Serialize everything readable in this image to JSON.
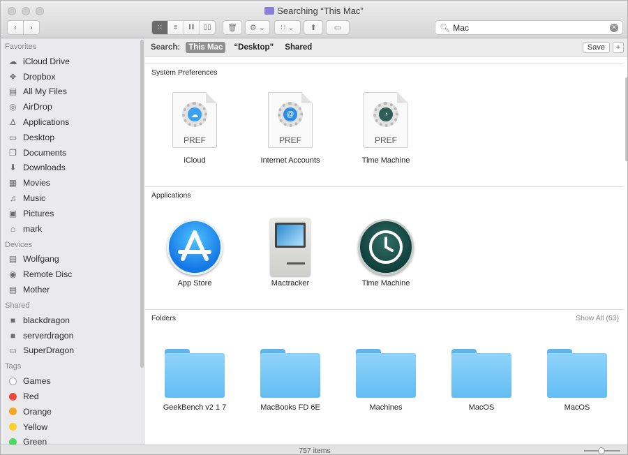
{
  "window": {
    "title": "Searching “This Mac”"
  },
  "toolbar": {
    "search_value": "Mac",
    "view_modes": [
      "icon",
      "list",
      "column",
      "cover-flow"
    ],
    "active_view": "icon"
  },
  "sidebar": {
    "favorites_header": "Favorites",
    "favorites": [
      {
        "label": "iCloud Drive",
        "icon": "cloud-icon"
      },
      {
        "label": "Dropbox",
        "icon": "dropbox-icon"
      },
      {
        "label": "All My Files",
        "icon": "all-files-icon"
      },
      {
        "label": "AirDrop",
        "icon": "airdrop-icon"
      },
      {
        "label": "Applications",
        "icon": "applications-icon"
      },
      {
        "label": "Desktop",
        "icon": "desktop-icon"
      },
      {
        "label": "Documents",
        "icon": "documents-icon"
      },
      {
        "label": "Downloads",
        "icon": "downloads-icon"
      },
      {
        "label": "Movies",
        "icon": "movies-icon"
      },
      {
        "label": "Music",
        "icon": "music-icon"
      },
      {
        "label": "Pictures",
        "icon": "pictures-icon"
      },
      {
        "label": "mark",
        "icon": "home-icon"
      }
    ],
    "devices_header": "Devices",
    "devices": [
      {
        "label": "Wolfgang",
        "icon": "hard-drive-icon"
      },
      {
        "label": "Remote Disc",
        "icon": "disc-icon"
      },
      {
        "label": "Mother",
        "icon": "hard-drive-icon"
      }
    ],
    "shared_header": "Shared",
    "shared": [
      {
        "label": "blackdragon",
        "icon": "computer-icon"
      },
      {
        "label": "serverdragon",
        "icon": "computer-icon"
      },
      {
        "label": "SuperDragon",
        "icon": "laptop-icon"
      }
    ],
    "tags_header": "Tags",
    "tags": [
      {
        "label": "Games",
        "color": "#ffffff"
      },
      {
        "label": "Red",
        "color": "#f0483e"
      },
      {
        "label": "Orange",
        "color": "#f5a623"
      },
      {
        "label": "Yellow",
        "color": "#f7d02c"
      },
      {
        "label": "Green",
        "color": "#4cd964"
      }
    ]
  },
  "search_scope": {
    "label": "Search:",
    "options": [
      "This Mac",
      "“Desktop”",
      "Shared"
    ],
    "selected": "This Mac",
    "save_label": "Save",
    "add_label": "+"
  },
  "sections": {
    "system_preferences": {
      "title": "System Preferences",
      "items": [
        {
          "label": "iCloud",
          "doc_label": "PREF",
          "badge_color": "#3aa0f0",
          "badge_glyph": "☁"
        },
        {
          "label": "Internet Accounts",
          "doc_label": "PREF",
          "badge_color": "#2a8ee8",
          "badge_glyph": "@"
        },
        {
          "label": "Time Machine",
          "doc_label": "PREF",
          "badge_color": "#2f5d57",
          "badge_glyph": "◔"
        }
      ]
    },
    "applications": {
      "title": "Applications",
      "items": [
        {
          "label": "App Store",
          "icon": "app-store-icon"
        },
        {
          "label": "Mactracker",
          "icon": "mactracker-icon"
        },
        {
          "label": "Time Machine",
          "icon": "time-machine-icon"
        }
      ]
    },
    "folders": {
      "title": "Folders",
      "show_all": "Show All (63)",
      "items": [
        {
          "label": "GeekBench v2 1 7"
        },
        {
          "label": "MacBooks FD 6E"
        },
        {
          "label": "Machines"
        },
        {
          "label": "MacOS"
        },
        {
          "label": "MacOS"
        }
      ]
    }
  },
  "status": {
    "item_count": "757 items"
  }
}
